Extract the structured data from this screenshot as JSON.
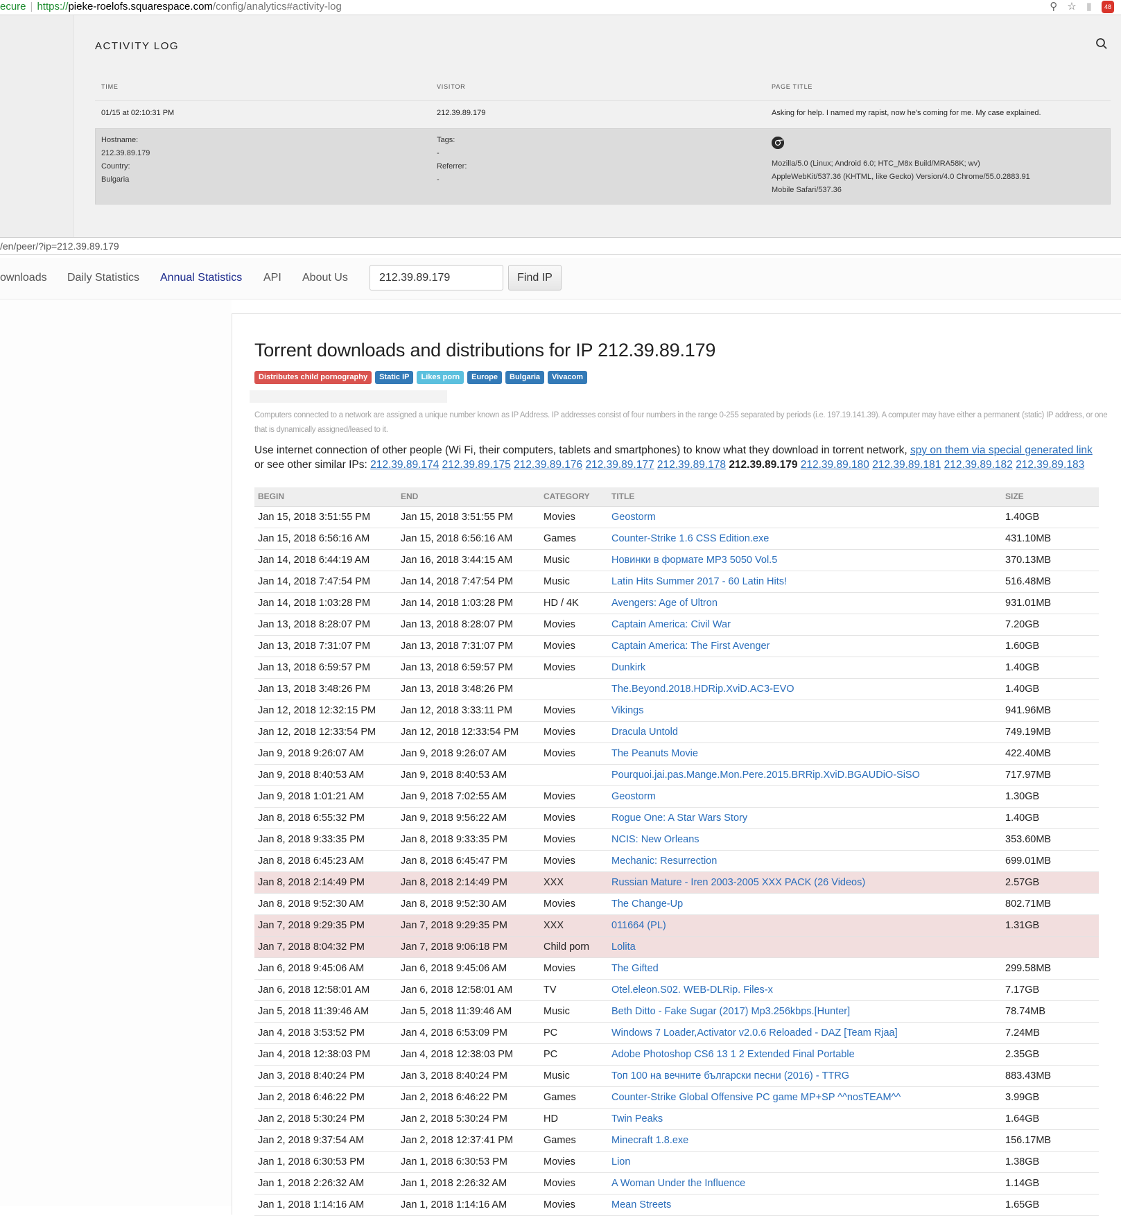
{
  "browser": {
    "secure_label": "ecure",
    "url_scheme": "https://",
    "url_host": "pieke-roelofs.squarespace.com",
    "url_path": "/config/analytics#activity-log",
    "ext_badge": "48"
  },
  "activity_log": {
    "title": "ACTIVITY LOG",
    "col_time": "TIME",
    "col_visitor": "VISITOR",
    "col_page_title": "PAGE TITLE",
    "time": "01/15 at 02:10:31 PM",
    "visitor": "212.39.89.179",
    "page_title": "Asking for help. I named my rapist, now he's coming for me. My case explained.",
    "hostname_label": "Hostname:",
    "hostname": "212.39.89.179",
    "country_label": "Country:",
    "country": "Bulgaria",
    "tags_label": "Tags:",
    "tags": "-",
    "referrer_label": "Referrer:",
    "referrer": "-",
    "ua_line1": "Mozilla/5.0 (Linux; Android 6.0; HTC_M8x Build/MRA58K; wv)",
    "ua_line2": "AppleWebKit/537.36 (KHTML, like Gecko) Version/4.0 Chrome/55.0.2883.91",
    "ua_line3": "Mobile Safari/537.36"
  },
  "browser2": {
    "url": "/en/peer/?ip=212.39.89.179"
  },
  "nav": {
    "items": [
      {
        "label": "ownloads"
      },
      {
        "label": "Daily Statistics"
      },
      {
        "label": "Annual Statistics"
      },
      {
        "label": "API"
      },
      {
        "label": "About Us"
      }
    ],
    "ip_value": "212.39.89.179",
    "find_button": "Find IP"
  },
  "main": {
    "title": "Torrent downloads and distributions for IP 212.39.89.179",
    "badges": [
      {
        "label": "Distributes child pornography",
        "color": "#d9534f"
      },
      {
        "label": "Static IP",
        "color": "#337ab7"
      },
      {
        "label": "Likes porn",
        "color": "#5bc0de"
      },
      {
        "label": "Europe",
        "color": "#337ab7"
      },
      {
        "label": "Bulgaria",
        "color": "#337ab7"
      },
      {
        "label": "Vivacom",
        "color": "#337ab7"
      }
    ],
    "description": "Computers connected to a network are assigned a unique number known as IP Address. IP addresses consist of four numbers in the range 0-255 separated by periods (i.e. 197.19.141.39). A computer may have either a permanent (static) IP address, or one that is dynamically assigned/leased to it.",
    "use_text": "Use internet connection of other people (Wi Fi, their computers, tablets and smartphones) to know what they download in torrent network,",
    "spy_link": "spy on them via special generated link",
    "similar_text": "or see other similar IPs:",
    "similar_ips": [
      "212.39.89.174",
      "212.39.89.175",
      "212.39.89.176",
      "212.39.89.177",
      "212.39.89.178",
      "212.39.89.179",
      "212.39.89.180",
      "212.39.89.181",
      "212.39.89.182",
      "212.39.89.183"
    ],
    "current_ip": "212.39.89.179"
  },
  "table": {
    "headers": {
      "begin": "BEGIN",
      "end": "END",
      "category": "CATEGORY",
      "title": "TITLE",
      "size": "SIZE"
    },
    "rows": [
      {
        "begin": "Jan 15, 2018 3:51:55 PM",
        "end": "Jan 15, 2018 3:51:55 PM",
        "category": "Movies",
        "title": "Geostorm",
        "size": "1.40GB",
        "flag": false
      },
      {
        "begin": "Jan 15, 2018 6:56:16 AM",
        "end": "Jan 15, 2018 6:56:16 AM",
        "category": "Games",
        "title": "Counter-Strike 1.6 CSS Edition.exe",
        "size": "431.10MB",
        "flag": false
      },
      {
        "begin": "Jan 14, 2018 6:44:19 AM",
        "end": "Jan 16, 2018 3:44:15 AM",
        "category": "Music",
        "title": "Новинки в формате MP3 5050 Vol.5",
        "size": "370.13MB",
        "flag": false
      },
      {
        "begin": "Jan 14, 2018 7:47:54 PM",
        "end": "Jan 14, 2018 7:47:54 PM",
        "category": "Music",
        "title": "Latin Hits Summer 2017 - 60 Latin Hits!",
        "size": "516.48MB",
        "flag": false
      },
      {
        "begin": "Jan 14, 2018 1:03:28 PM",
        "end": "Jan 14, 2018 1:03:28 PM",
        "category": "HD / 4K",
        "title": "Avengers: Age of Ultron",
        "size": "931.01MB",
        "flag": false
      },
      {
        "begin": "Jan 13, 2018 8:28:07 PM",
        "end": "Jan 13, 2018 8:28:07 PM",
        "category": "Movies",
        "title": "Captain America: Civil War",
        "size": "7.20GB",
        "flag": false
      },
      {
        "begin": "Jan 13, 2018 7:31:07 PM",
        "end": "Jan 13, 2018 7:31:07 PM",
        "category": "Movies",
        "title": "Captain America: The First Avenger",
        "size": "1.60GB",
        "flag": false
      },
      {
        "begin": "Jan 13, 2018 6:59:57 PM",
        "end": "Jan 13, 2018 6:59:57 PM",
        "category": "Movies",
        "title": "Dunkirk",
        "size": "1.40GB",
        "flag": false
      },
      {
        "begin": "Jan 13, 2018 3:48:26 PM",
        "end": "Jan 13, 2018 3:48:26 PM",
        "category": "",
        "title": "The.Beyond.2018.HDRip.XviD.AC3-EVO",
        "size": "1.40GB",
        "flag": false
      },
      {
        "begin": "Jan 12, 2018 12:32:15 PM",
        "end": "Jan 12, 2018 3:33:11 PM",
        "category": "Movies",
        "title": "Vikings",
        "size": "941.96MB",
        "flag": false
      },
      {
        "begin": "Jan 12, 2018 12:33:54 PM",
        "end": "Jan 12, 2018 12:33:54 PM",
        "category": "Movies",
        "title": "Dracula Untold",
        "size": "749.19MB",
        "flag": false
      },
      {
        "begin": "Jan 9, 2018 9:26:07 AM",
        "end": "Jan 9, 2018 9:26:07 AM",
        "category": "Movies",
        "title": "The Peanuts Movie",
        "size": "422.40MB",
        "flag": false
      },
      {
        "begin": "Jan 9, 2018 8:40:53 AM",
        "end": "Jan 9, 2018 8:40:53 AM",
        "category": "",
        "title": "Pourquoi.jai.pas.Mange.Mon.Pere.2015.BRRip.XviD.BGAUDiO-SiSO",
        "size": "717.97MB",
        "flag": false
      },
      {
        "begin": "Jan 9, 2018 1:01:21 AM",
        "end": "Jan 9, 2018 7:02:55 AM",
        "category": "Movies",
        "title": "Geostorm",
        "size": "1.30GB",
        "flag": false
      },
      {
        "begin": "Jan 8, 2018 6:55:32 PM",
        "end": "Jan 9, 2018 9:56:22 AM",
        "category": "Movies",
        "title": "Rogue One: A Star Wars Story",
        "size": "1.40GB",
        "flag": false
      },
      {
        "begin": "Jan 8, 2018 9:33:35 PM",
        "end": "Jan 8, 2018 9:33:35 PM",
        "category": "Movies",
        "title": "NCIS: New Orleans",
        "size": "353.60MB",
        "flag": false
      },
      {
        "begin": "Jan 8, 2018 6:45:23 AM",
        "end": "Jan 8, 2018 6:45:47 PM",
        "category": "Movies",
        "title": "Mechanic: Resurrection",
        "size": "699.01MB",
        "flag": false
      },
      {
        "begin": "Jan 8, 2018 2:14:49 PM",
        "end": "Jan 8, 2018 2:14:49 PM",
        "category": "XXX",
        "title": "Russian Mature - Iren 2003-2005 XXX PACK (26 Videos)",
        "size": "2.57GB",
        "flag": true
      },
      {
        "begin": "Jan 8, 2018 9:52:30 AM",
        "end": "Jan 8, 2018 9:52:30 AM",
        "category": "Movies",
        "title": "The Change-Up",
        "size": "802.71MB",
        "flag": false
      },
      {
        "begin": "Jan 7, 2018 9:29:35 PM",
        "end": "Jan 7, 2018 9:29:35 PM",
        "category": "XXX",
        "title": "011664 (PL)",
        "size": "1.31GB",
        "flag": true
      },
      {
        "begin": "Jan 7, 2018 8:04:32 PM",
        "end": "Jan 7, 2018 9:06:18 PM",
        "category": "Child porn",
        "title": "Lolita",
        "size": "",
        "flag": true
      },
      {
        "begin": "Jan 6, 2018 9:45:06 AM",
        "end": "Jan 6, 2018 9:45:06 AM",
        "category": "Movies",
        "title": "The Gifted",
        "size": "299.58MB",
        "flag": false
      },
      {
        "begin": "Jan 6, 2018 12:58:01 AM",
        "end": "Jan 6, 2018 12:58:01 AM",
        "category": "TV",
        "title": "Otel.eleon.S02. WEB-DLRip. Files-x",
        "size": "7.17GB",
        "flag": false
      },
      {
        "begin": "Jan 5, 2018 11:39:46 AM",
        "end": "Jan 5, 2018 11:39:46 AM",
        "category": "Music",
        "title": "Beth Ditto - Fake Sugar (2017) Mp3.256kbps.[Hunter]",
        "size": "78.74MB",
        "flag": false
      },
      {
        "begin": "Jan 4, 2018 3:53:52 PM",
        "end": "Jan 4, 2018 6:53:09 PM",
        "category": "PC",
        "title": "Windows 7 Loader,Activator v2.0.6 Reloaded - DAZ [Team Rjaa]",
        "size": "7.24MB",
        "flag": false
      },
      {
        "begin": "Jan 4, 2018 12:38:03 PM",
        "end": "Jan 4, 2018 12:38:03 PM",
        "category": "PC",
        "title": "Adobe Photoshop CS6 13 1 2 Extended Final Portable",
        "size": "2.35GB",
        "flag": false
      },
      {
        "begin": "Jan 3, 2018 8:40:24 PM",
        "end": "Jan 3, 2018 8:40:24 PM",
        "category": "Music",
        "title": "Топ 100 на вечните български песни (2016) - TTRG",
        "size": "883.43MB",
        "flag": false
      },
      {
        "begin": "Jan 2, 2018 6:46:22 PM",
        "end": "Jan 2, 2018 6:46:22 PM",
        "category": "Games",
        "title": "Counter-Strike Global Offensive PC game MP+SP ^^nosTEAM^^",
        "size": "3.99GB",
        "flag": false
      },
      {
        "begin": "Jan 2, 2018 5:30:24 PM",
        "end": "Jan 2, 2018 5:30:24 PM",
        "category": "HD",
        "title": "Twin Peaks",
        "size": "1.64GB",
        "flag": false
      },
      {
        "begin": "Jan 2, 2018 9:37:54 AM",
        "end": "Jan 2, 2018 12:37:41 PM",
        "category": "Games",
        "title": "Minecraft 1.8.exe",
        "size": "156.17MB",
        "flag": false
      },
      {
        "begin": "Jan 1, 2018 6:30:53 PM",
        "end": "Jan 1, 2018 6:30:53 PM",
        "category": "Movies",
        "title": "Lion",
        "size": "1.38GB",
        "flag": false
      },
      {
        "begin": "Jan 1, 2018 2:26:32 AM",
        "end": "Jan 1, 2018 2:26:32 AM",
        "category": "Movies",
        "title": "A Woman Under the Influence",
        "size": "1.14GB",
        "flag": false
      },
      {
        "begin": "Jan 1, 2018 1:14:16 AM",
        "end": "Jan 1, 2018 1:14:16 AM",
        "category": "Movies",
        "title": "Mean Streets",
        "size": "1.65GB",
        "flag": false
      }
    ]
  }
}
